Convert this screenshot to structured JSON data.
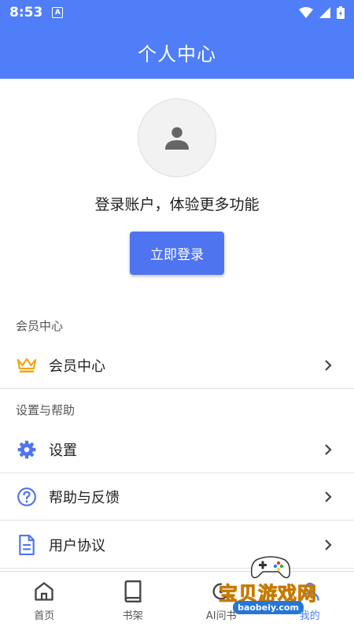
{
  "status_bar": {
    "time": "8:53",
    "badge_letter": "A"
  },
  "header": {
    "title": "个人中心"
  },
  "profile": {
    "prompt": "登录账户，体验更多功能",
    "login_label": "立即登录"
  },
  "sections": [
    {
      "title": "会员中心",
      "items": [
        {
          "label": "会员中心",
          "icon": "crown-icon"
        }
      ]
    },
    {
      "title": "设置与帮助",
      "items": [
        {
          "label": "设置",
          "icon": "gear-icon"
        },
        {
          "label": "帮助与反馈",
          "icon": "help-circle-icon"
        },
        {
          "label": "用户协议",
          "icon": "document-icon"
        }
      ]
    }
  ],
  "bottom_nav": [
    {
      "label": "首页",
      "icon": "home-icon"
    },
    {
      "label": "书架",
      "icon": "book-icon"
    },
    {
      "label": "AI问书",
      "icon": "ai-icon"
    },
    {
      "label": "我的",
      "icon": "person-icon"
    }
  ],
  "watermark": {
    "text": "宝贝游戏网",
    "url": "baobeiy.com"
  },
  "colors": {
    "primary": "#4f7ef8",
    "button": "#4f74f0",
    "crown": "#f2a514",
    "icon": "#4f74f0"
  }
}
